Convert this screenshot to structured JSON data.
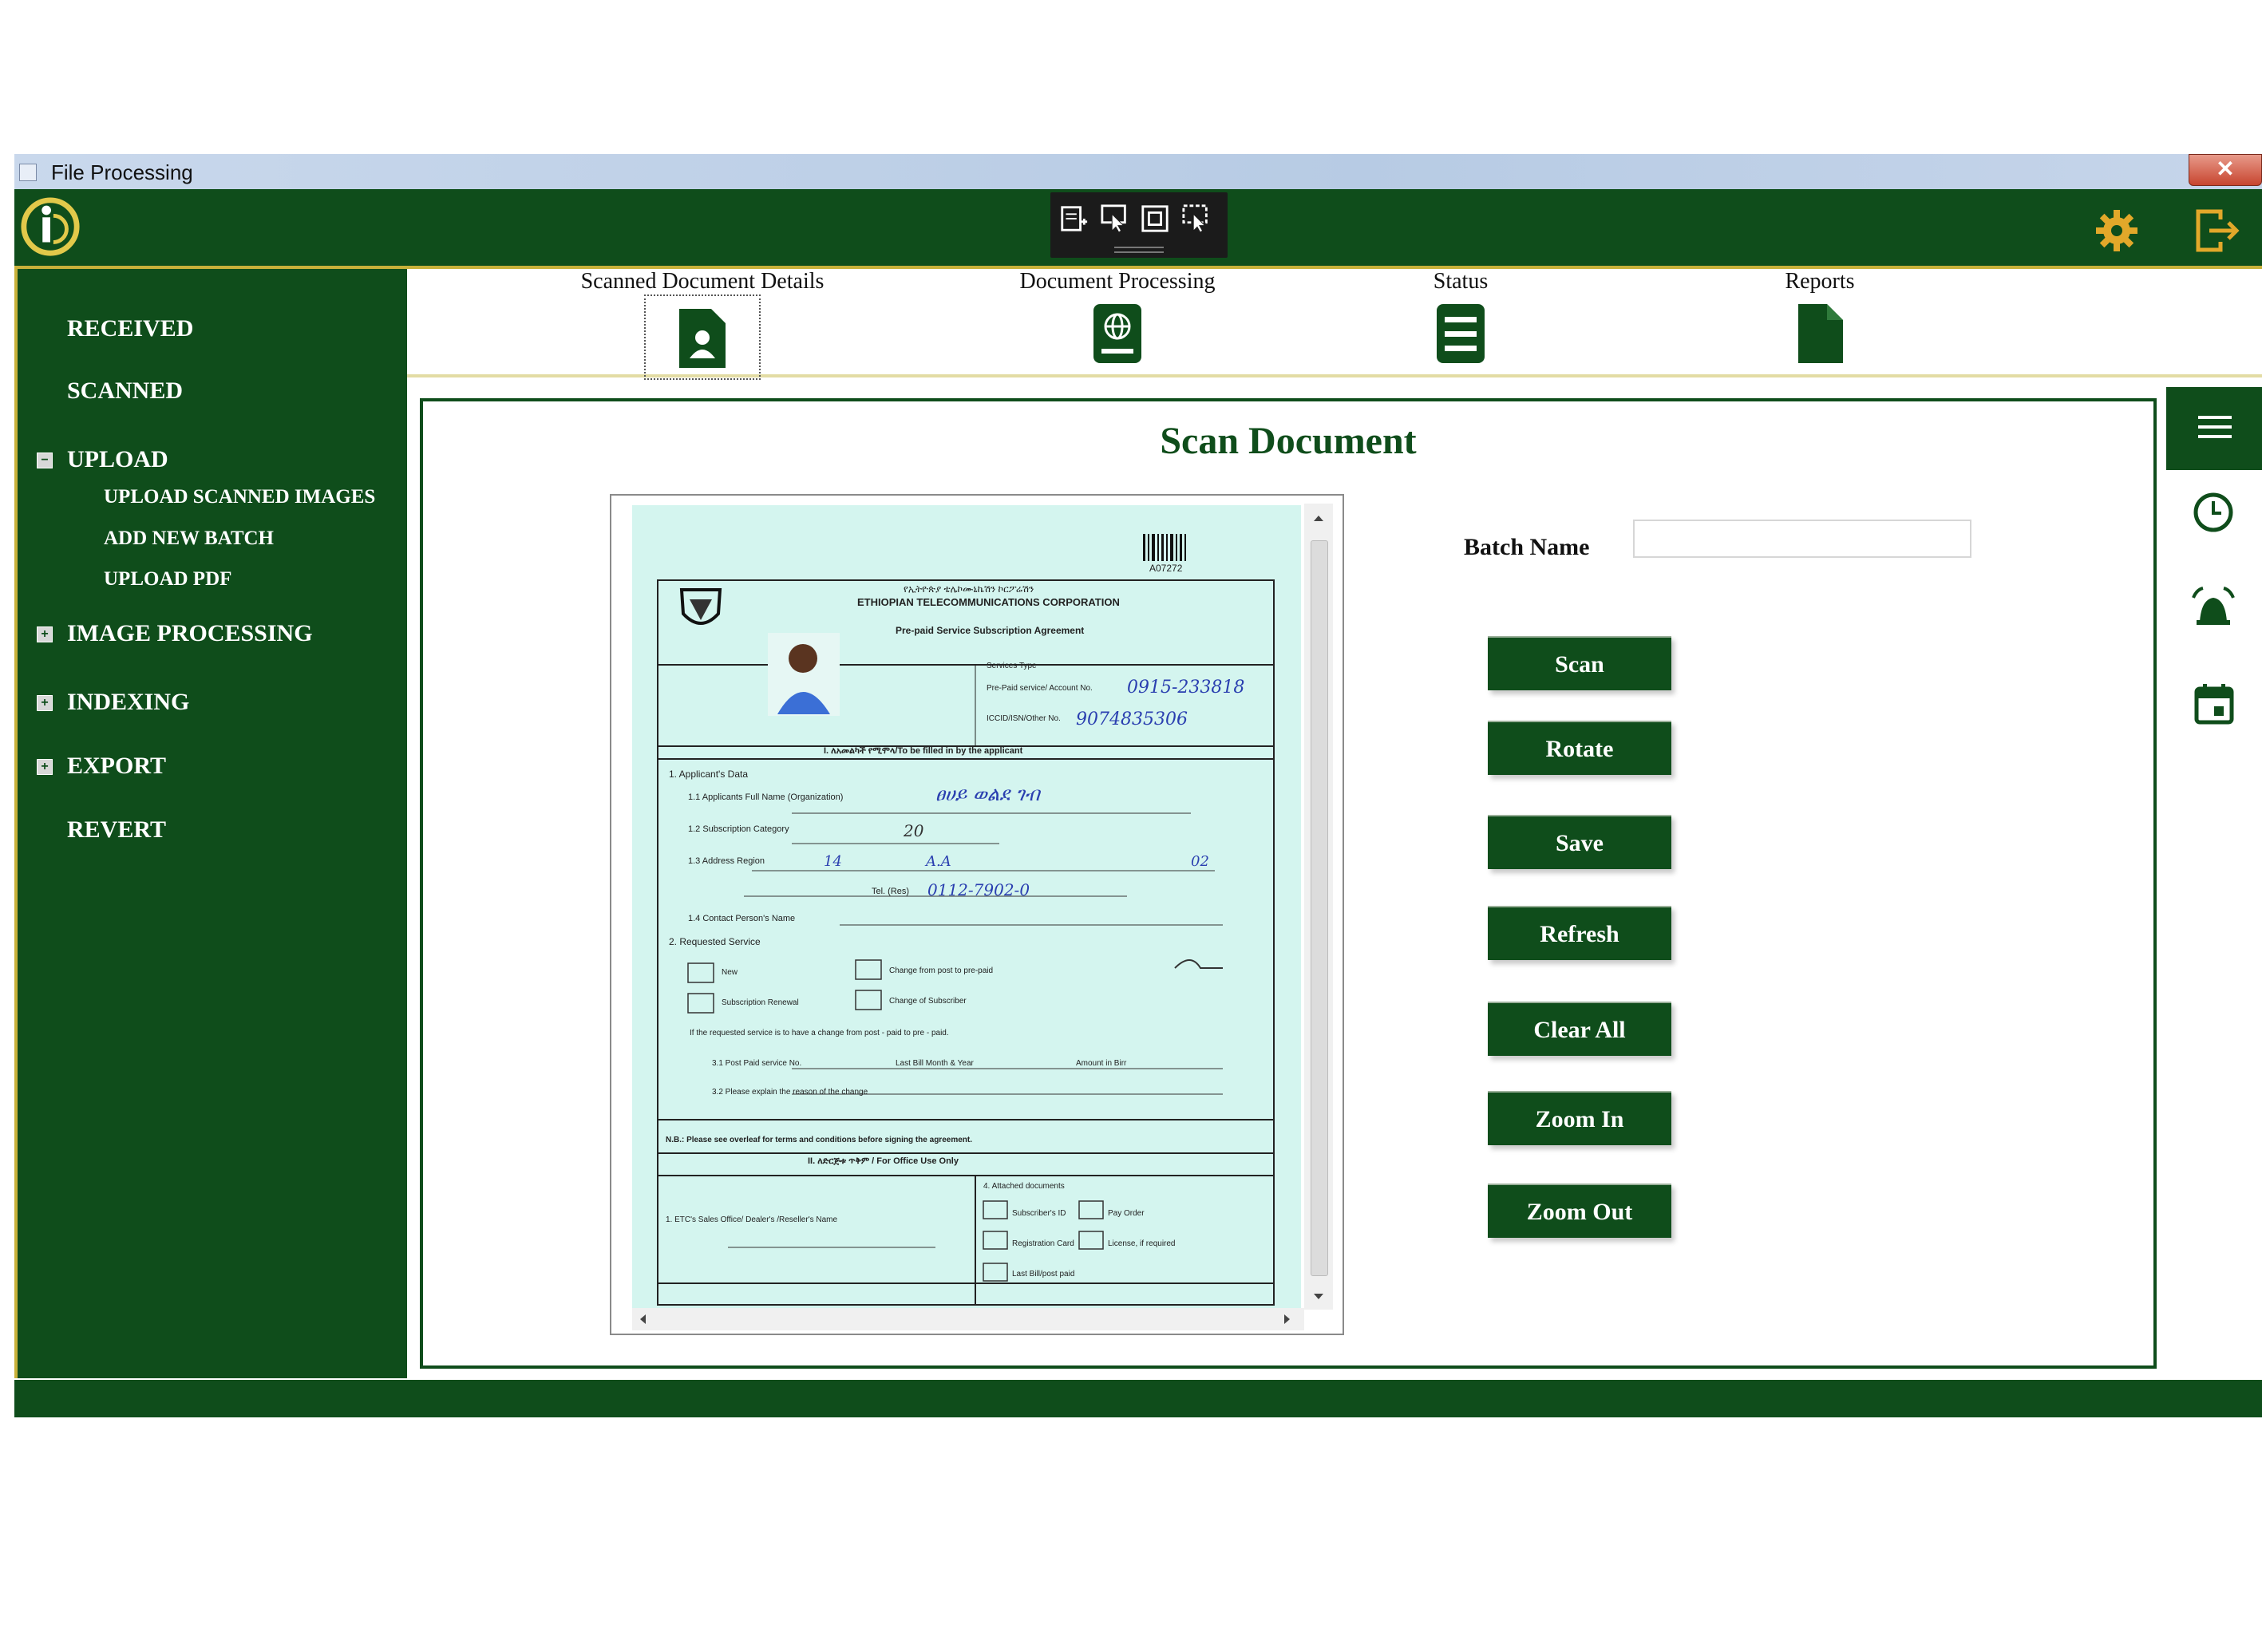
{
  "window": {
    "title": "File Processing",
    "close_label": "✕"
  },
  "toolbar": {
    "tools": [
      "scan-region-icon",
      "select-pointer-icon",
      "fit-frame-icon",
      "crop-select-icon"
    ],
    "right_icons": [
      "gear-icon",
      "logout-icon"
    ]
  },
  "colors": {
    "primary": "#0f4d1b",
    "accent": "#c8b13a",
    "scan_bg": "#d4f5ef"
  },
  "sidebar": {
    "items": [
      {
        "label": "RECEIVED",
        "expandable": false
      },
      {
        "label": "SCANNED",
        "expandable": false
      },
      {
        "label": "UPLOAD",
        "expandable": true,
        "expanded": true,
        "children": [
          "UPLOAD SCANNED IMAGES",
          "ADD NEW BATCH",
          "UPLOAD PDF"
        ]
      },
      {
        "label": "IMAGE PROCESSING",
        "expandable": true,
        "expanded": false
      },
      {
        "label": "INDEXING",
        "expandable": true,
        "expanded": false
      },
      {
        "label": "EXPORT",
        "expandable": true,
        "expanded": false
      },
      {
        "label": "REVERT",
        "expandable": false
      }
    ],
    "collapse_symbol": "−",
    "expand_symbol": "+"
  },
  "tabs": [
    {
      "label": "Scanned Document Details",
      "icon": "person-document-icon",
      "selected": true
    },
    {
      "label": "Document Processing",
      "icon": "globe-document-icon",
      "selected": false
    },
    {
      "label": "Status",
      "icon": "list-icon",
      "selected": false
    },
    {
      "label": "Reports",
      "icon": "file-icon",
      "selected": false
    }
  ],
  "main": {
    "heading": "Scan Document",
    "batch_label": "Batch Name",
    "batch_value": "",
    "buttons": [
      "Scan",
      "Rotate",
      "Save",
      "Refresh",
      "Clear All",
      "Zoom In",
      "Zoom Out"
    ]
  },
  "right_panel": {
    "icons": [
      "hamburger-menu-icon",
      "clock-icon",
      "alarm-bell-icon",
      "calendar-icon"
    ]
  },
  "scanned_document": {
    "barcode_number": "A07272",
    "org_amharic": "የኢትዮጵያ ቴሌኮሙኒኬሽን ኮርፖሬሽን",
    "org_name": "ETHIOPIAN TELECOMMUNICATIONS CORPORATION",
    "agreement_title": "Pre-paid Service Subscription Agreement",
    "section_applicant": "I. ለአመልካች የሚሞላ/To be filled in by the applicant",
    "applicants_data": "1. Applicant's Data",
    "full_name_label": "1.1 Applicants Full Name (Organization)",
    "full_name_value": "ፀሀይ ወልደ ገብ",
    "category_label": "1.2 Subscription Category",
    "category_value": "20",
    "address_label": "1.3 Address Region",
    "region_value": "14",
    "city_value": "A.A",
    "kebele_value": "02",
    "tel_label": "Tel. (Res)",
    "tel_value": "0112-7902-0",
    "contact_label": "1.4 Contact Person's Name",
    "service_requested": "2. Requested Service",
    "new_label": "New",
    "renewal_label": "Subscription Renewal",
    "change_label": "Change from post to pre-paid",
    "change_subscriber_label": "Change of Subscriber",
    "change_note": "If the requested service is to have a change from post - paid to pre - paid.",
    "post_paid_label": "3.1 Post Paid service No.",
    "last_bill_label": "Last Bill Month & Year",
    "amount_label": "Amount in Birr",
    "reason_label": "3.2 Please explain the reason of the change",
    "nb_note": "N.B.: Please see overleaf for terms and conditions before signing the agreement.",
    "section_office": "II. ለድርጅቱ ጥቅም / For Office Use Only",
    "etc_label": "1. ETC's Sales Office/ Dealer's /Reseller's Name",
    "attached_label": "4. Attached documents",
    "subscriber_id": "Subscriber's ID",
    "pay_order": "Pay Order",
    "registration_card": "Registration Card",
    "license_label": "License, if required",
    "last_bill_paid": "Last Bill/post paid",
    "services_type": "Services Type",
    "account_label": "Pre-Paid service/ Account No.",
    "account_value": "0915-233818",
    "iccid_label": "ICCID/ISN/Other No.",
    "iccid_value": "9074835306"
  }
}
